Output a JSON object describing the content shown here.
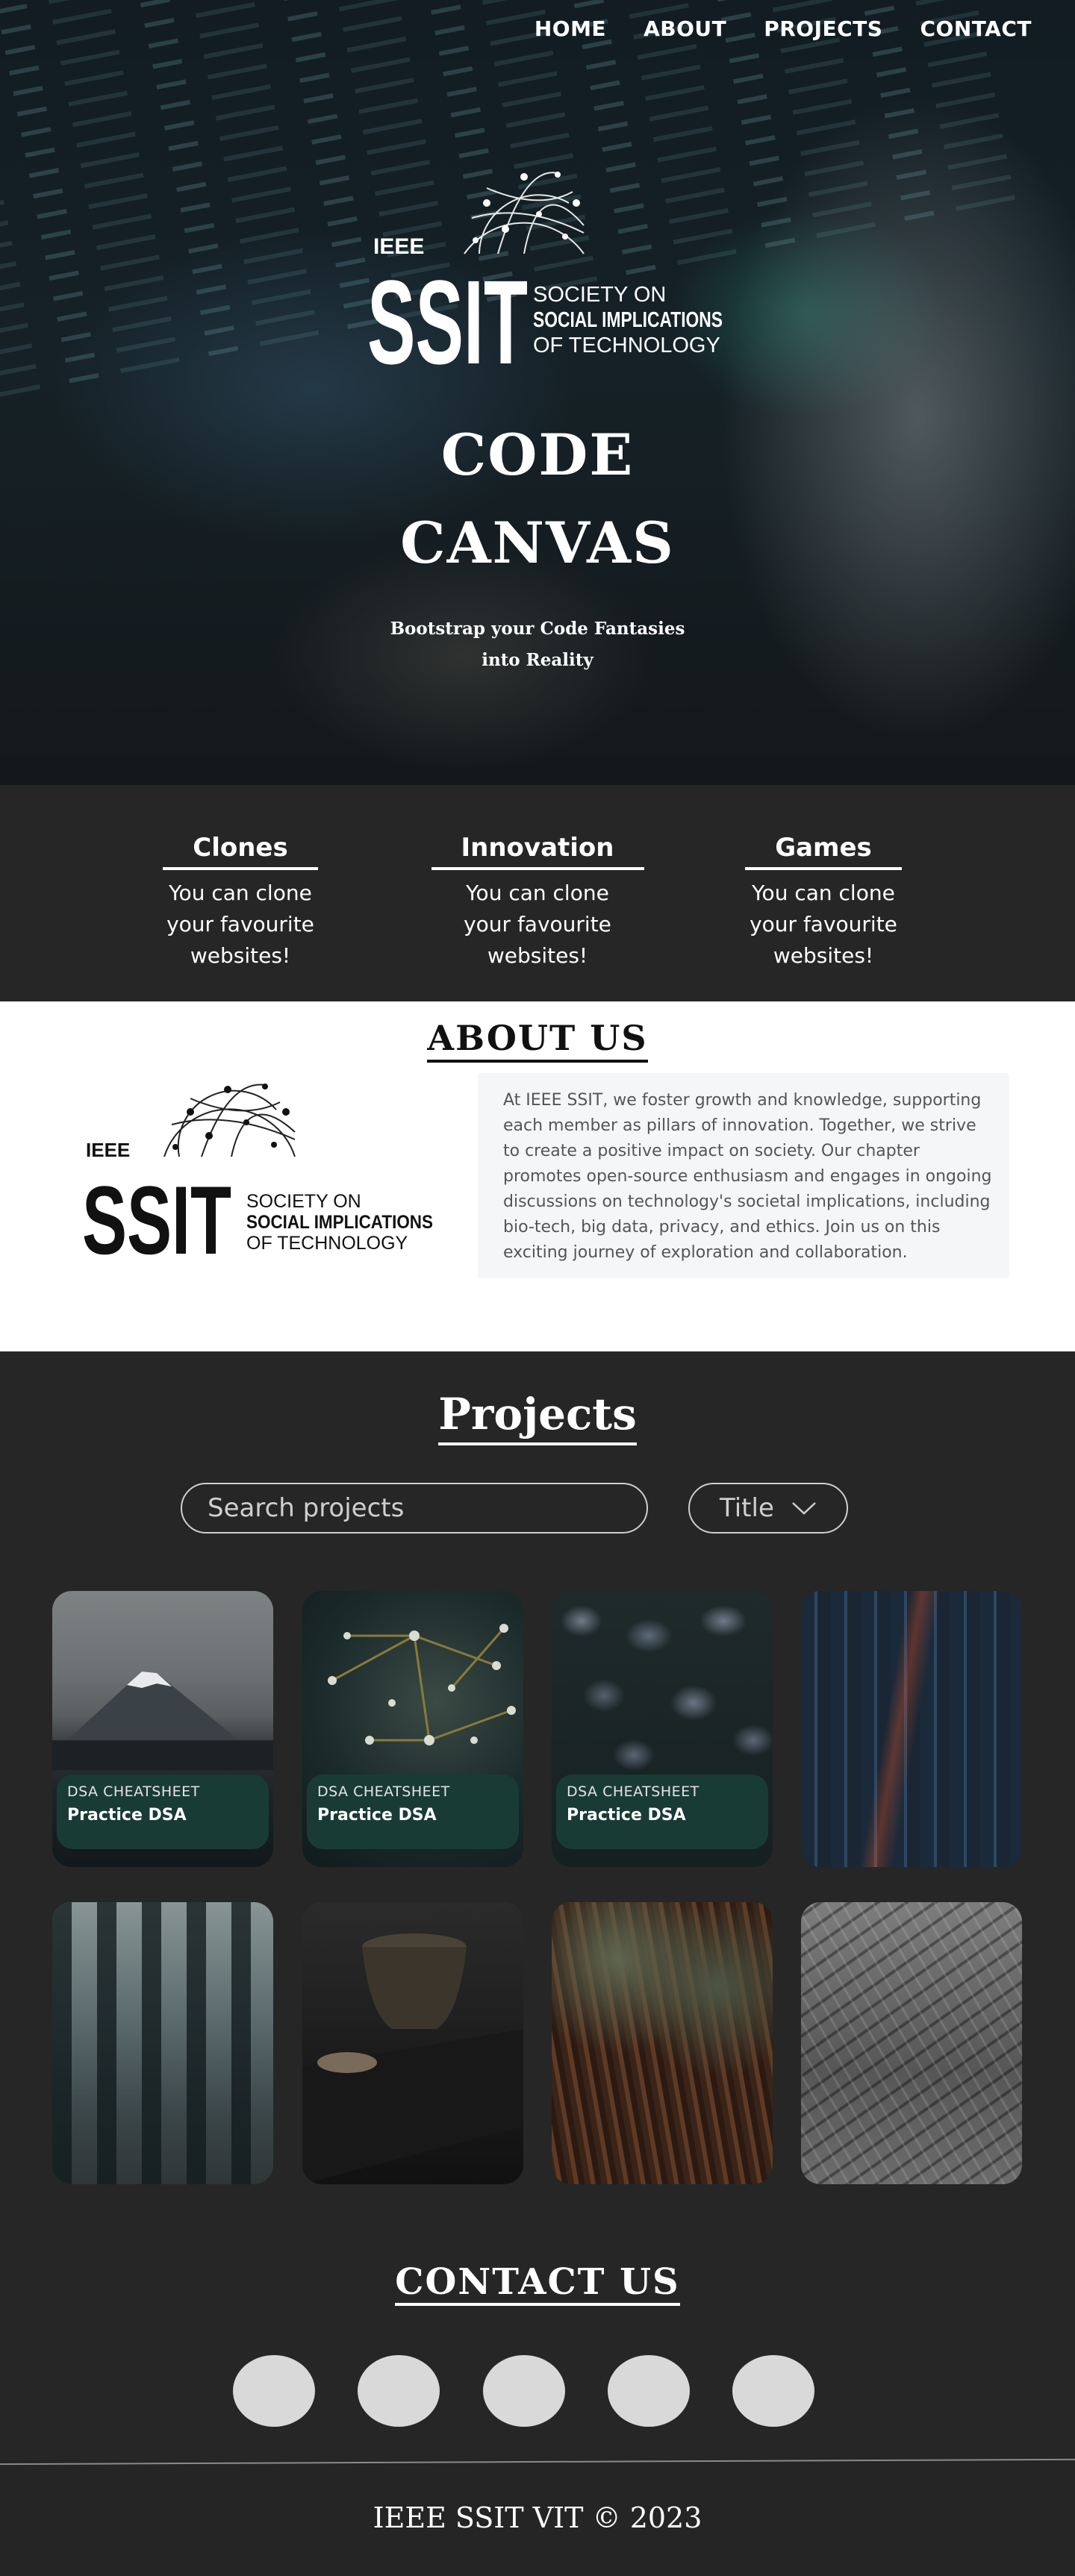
{
  "nav": {
    "items": [
      "HOME",
      "ABOUT",
      "PROJECTS",
      "CONTACT"
    ]
  },
  "hero": {
    "logo": {
      "ieee": "IEEE",
      "ssit": "SSIT",
      "line1": "SOCIETY ON",
      "line2": "SOCIAL IMPLICATIONS",
      "line3": "OF TECHNOLOGY"
    },
    "title_line1": "CODE",
    "title_line2": "CANVAS",
    "subtitle": "Bootstrap your Code Fantasies into Reality"
  },
  "features": [
    {
      "title": "Clones",
      "line1": "You can clone",
      "line2": "your favourite websites!"
    },
    {
      "title": "Innovation",
      "line1": "You can clone",
      "line2": "your favourite websites!"
    },
    {
      "title": "Games",
      "line1": "You can clone",
      "line2": "your favourite websites!"
    }
  ],
  "about": {
    "title": "ABOUT US",
    "text": "At IEEE SSIT, we foster growth and knowledge, supporting each member as pillars of innovation. Together, we strive to create a positive impact on society. Our chapter promotes open-source enthusiasm and engages in ongoing discussions on technology's societal implications, including bio-tech, big data, privacy, and ethics. Join us on this exciting journey of exploration and collaboration."
  },
  "projects": {
    "title": "Projects",
    "search_placeholder": "Search projects",
    "sort_label": "Title",
    "cards": [
      {
        "kicker": "DSA CHEATSHEET",
        "title": "Practice DSA",
        "scene": "mountain"
      },
      {
        "kicker": "DSA CHEATSHEET",
        "title": "Practice DSA",
        "scene": "flowers"
      },
      {
        "kicker": "DSA CHEATSHEET",
        "title": "Practice DSA",
        "scene": "leaves"
      },
      {
        "kicker": "",
        "title": "",
        "scene": "city"
      },
      {
        "kicker": "",
        "title": "",
        "scene": "forest"
      },
      {
        "kicker": "",
        "title": "",
        "scene": "cup"
      },
      {
        "kicker": "",
        "title": "",
        "scene": "moss"
      },
      {
        "kicker": "",
        "title": "",
        "scene": "rock"
      }
    ]
  },
  "contact": {
    "title": "CONTACT US",
    "icons": [
      "contact-circle-1",
      "contact-circle-2",
      "contact-circle-3",
      "contact-circle-4",
      "contact-circle-5"
    ]
  },
  "footer": {
    "text": "IEEE SSIT VIT © 2023"
  }
}
